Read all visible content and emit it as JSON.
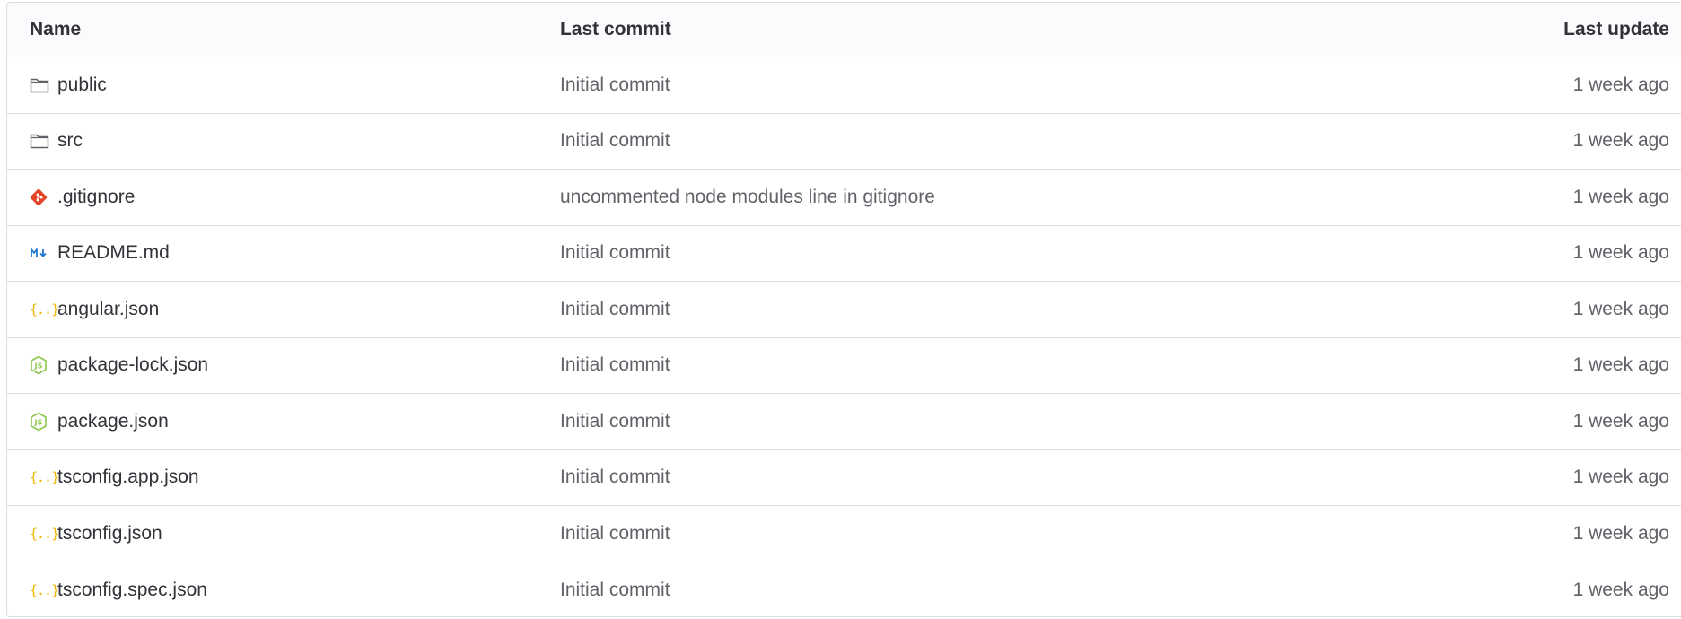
{
  "headers": {
    "name": "Name",
    "last_commit": "Last commit",
    "last_update": "Last update"
  },
  "rows": [
    {
      "name": "public",
      "icon": "folder-icon",
      "commit": "Initial commit",
      "updated": "1 week ago"
    },
    {
      "name": "src",
      "icon": "folder-icon",
      "commit": "Initial commit",
      "updated": "1 week ago"
    },
    {
      "name": ".gitignore",
      "icon": "git-icon",
      "commit": "uncommented node modules line in gitignore",
      "updated": "1 week ago"
    },
    {
      "name": "README.md",
      "icon": "markdown-icon",
      "commit": "Initial commit",
      "updated": "1 week ago"
    },
    {
      "name": "angular.json",
      "icon": "json-icon",
      "commit": "Initial commit",
      "updated": "1 week ago"
    },
    {
      "name": "package-lock.json",
      "icon": "nodejs-icon",
      "commit": "Initial commit",
      "updated": "1 week ago"
    },
    {
      "name": "package.json",
      "icon": "nodejs-icon",
      "commit": "Initial commit",
      "updated": "1 week ago"
    },
    {
      "name": "tsconfig.app.json",
      "icon": "json-icon",
      "commit": "Initial commit",
      "updated": "1 week ago"
    },
    {
      "name": "tsconfig.json",
      "icon": "json-icon",
      "commit": "Initial commit",
      "updated": "1 week ago"
    },
    {
      "name": "tsconfig.spec.json",
      "icon": "json-icon",
      "commit": "Initial commit",
      "updated": "1 week ago"
    }
  ],
  "colors": {
    "border": "#dcdcde",
    "header_bg": "#fbfafd",
    "text": "#333238",
    "muted_text": "#626168",
    "git_orange": "#e24329",
    "markdown_blue": "#1f78d1",
    "json_yellow": "#f0b400",
    "node_green": "#8cc84b"
  }
}
